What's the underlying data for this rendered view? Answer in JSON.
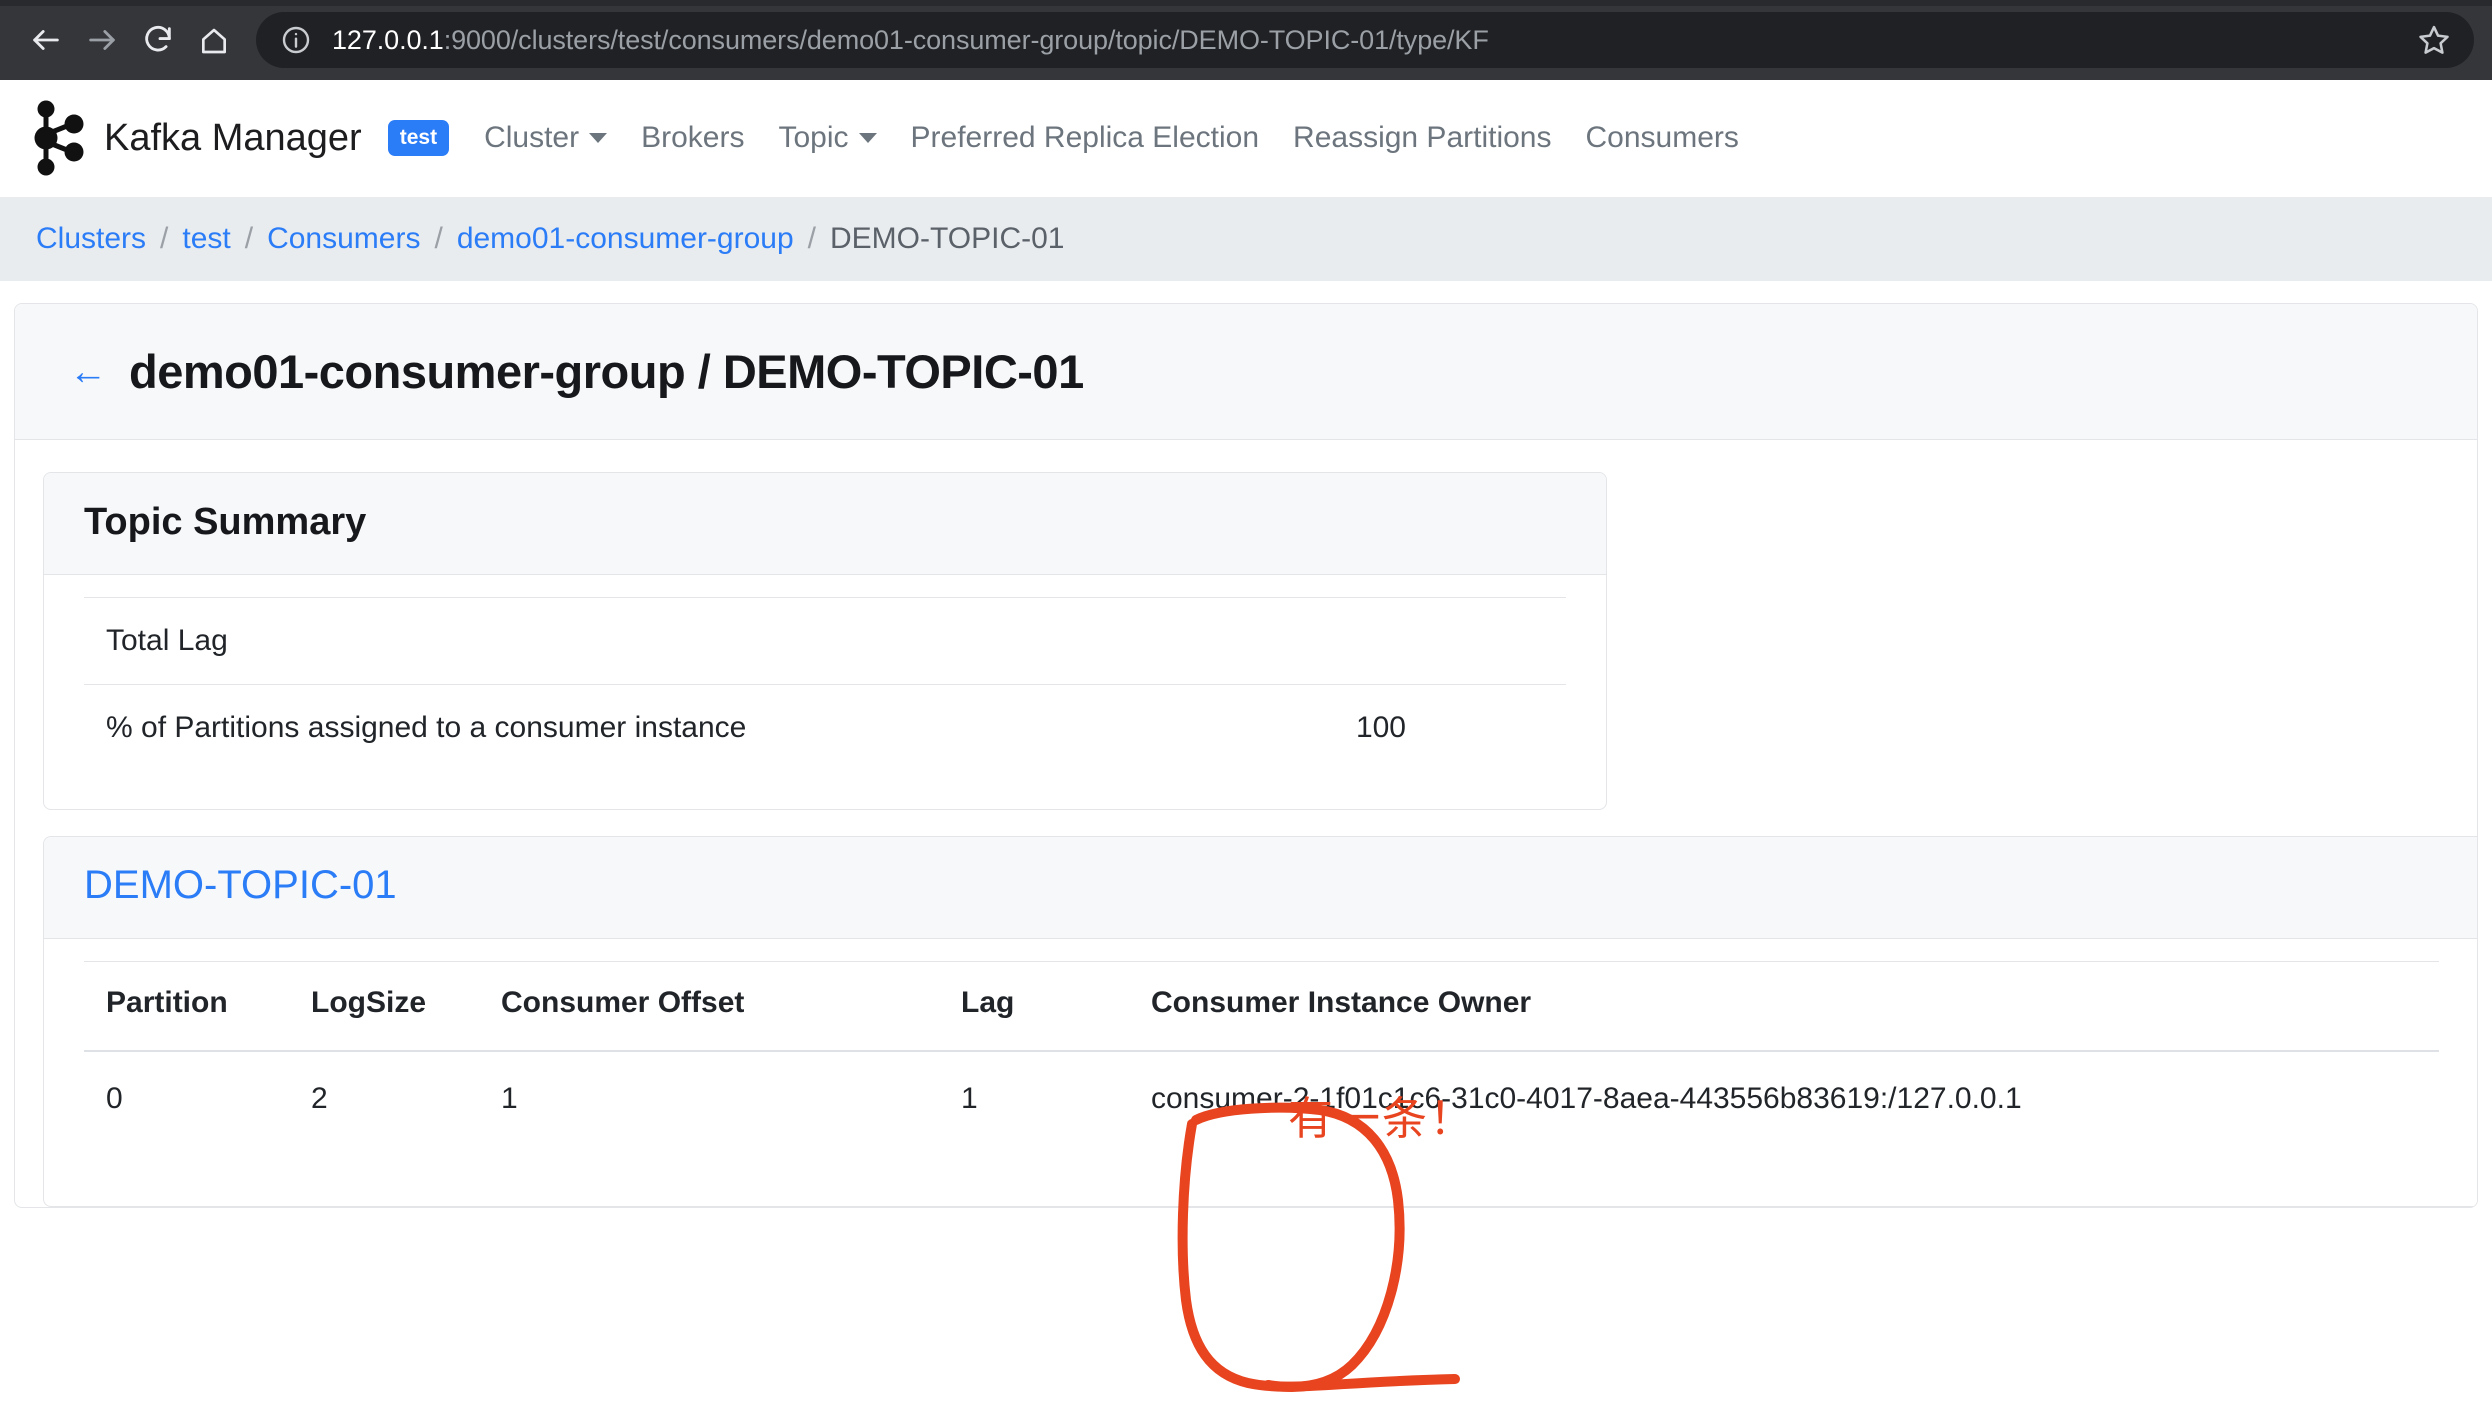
{
  "browser": {
    "back_icon": "arrow-left-icon",
    "forward_icon": "arrow-right-icon",
    "reload_icon": "reload-icon",
    "home_icon": "home-icon",
    "info_icon": "info-circle-icon",
    "star_icon": "bookmark-star-icon",
    "url_host": "127.0.0.1",
    "url_path": ":9000/clusters/test/consumers/demo01-consumer-group/topic/DEMO-TOPIC-01/type/KF",
    "url_full": "127.0.0.1:9000/clusters/test/consumers/demo01-consumer-group/topic/DEMO-TOPIC-01/type/KF"
  },
  "navbar": {
    "brand": "Kafka Manager",
    "cluster_badge": "test",
    "items": [
      {
        "label": "Cluster",
        "has_caret": true
      },
      {
        "label": "Brokers",
        "has_caret": false
      },
      {
        "label": "Topic",
        "has_caret": true
      },
      {
        "label": "Preferred Replica Election",
        "has_caret": false
      },
      {
        "label": "Reassign Partitions",
        "has_caret": false
      },
      {
        "label": "Consumers",
        "has_caret": false
      }
    ]
  },
  "breadcrumb": {
    "items": [
      {
        "label": "Clusters",
        "active": false
      },
      {
        "label": "test",
        "active": false
      },
      {
        "label": "Consumers",
        "active": false
      },
      {
        "label": "demo01-consumer-group",
        "active": false
      },
      {
        "label": "DEMO-TOPIC-01",
        "active": true
      }
    ],
    "separator": "/"
  },
  "page": {
    "back_arrow": "←",
    "title": "demo01-consumer-group / DEMO-TOPIC-01"
  },
  "summary": {
    "heading": "Topic Summary",
    "rows": [
      {
        "label": "Total Lag",
        "value": ""
      },
      {
        "label": "% of Partitions assigned to a consumer instance",
        "value": "100"
      }
    ]
  },
  "topic": {
    "heading": "DEMO-TOPIC-01",
    "columns": [
      "Partition",
      "LogSize",
      "Consumer Offset",
      "Lag",
      "Consumer Instance Owner"
    ],
    "rows": [
      {
        "partition": "0",
        "logsize": "2",
        "consumer_offset": "1",
        "lag": "1",
        "owner": "consumer-2-1f01c1c6-31c0-4017-8aea-443556b83619:/127.0.0.1"
      }
    ]
  },
  "annotation": {
    "text": "有一条！",
    "color": "#e8441f",
    "shape": "hand-drawn-oval-around-lag-column"
  },
  "colors": {
    "accent_blue": "#2b7cf7",
    "chrome_bg": "#35363a",
    "omnibox_bg": "#202124",
    "breadcrumb_bg": "#e9ecef",
    "panel_head_bg": "#f7f8f9",
    "border": "#e3e5e8",
    "annotation_red": "#e8441f"
  }
}
